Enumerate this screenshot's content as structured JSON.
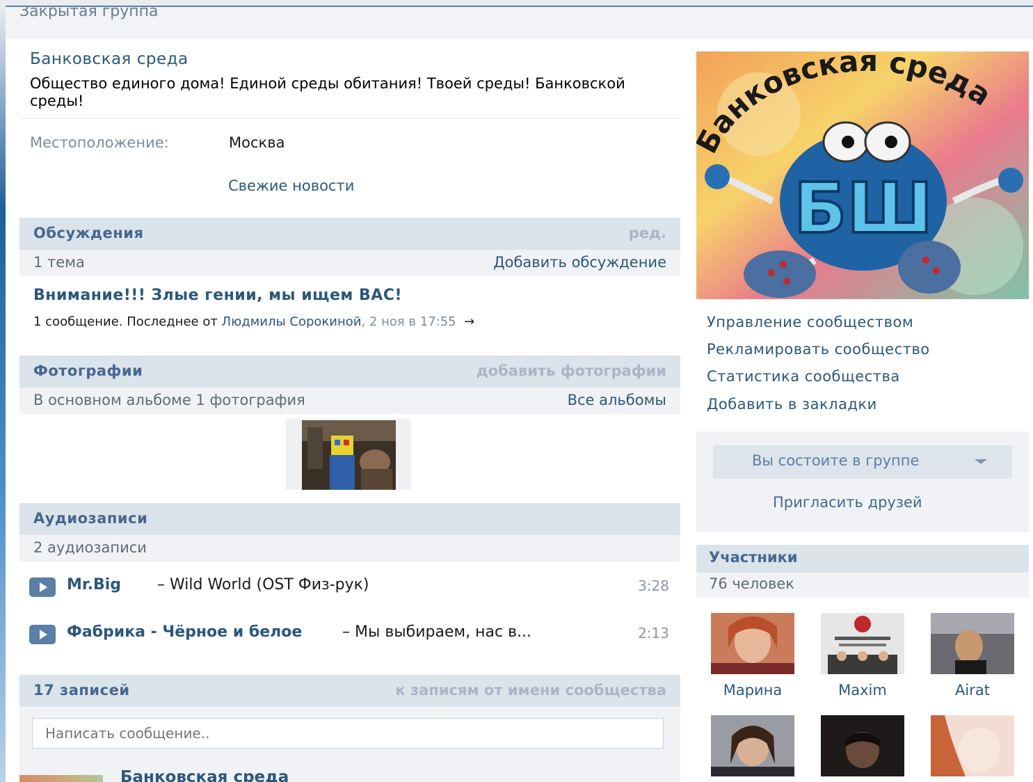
{
  "header": {
    "closed_group_label": "Закрытая группа"
  },
  "group": {
    "name": "Банковская среда",
    "description": "Общество единого дома! Единой среды обитания! Твоей среды! Банковской среды!",
    "location_label": "Местоположение:",
    "location_value": "Москва",
    "fresh_news": "Свежие новости"
  },
  "discussions": {
    "title": "Обсуждения",
    "edit": "ред.",
    "count": "1 тема",
    "add": "Добавить обсуждение",
    "topic": {
      "title": "Внимание!!! Злые гении, мы ищем ВАС!",
      "meta_prefix": "1 сообщение. Последнее от ",
      "meta_author": "Людмилы Сорокиной",
      "meta_date": ", 2 ноя в 17:55",
      "meta_arrow": "→"
    }
  },
  "photos": {
    "title": "Фотографии",
    "add": "добавить фотографии",
    "count": "В основном альбоме 1 фотография",
    "all": "Все альбомы"
  },
  "audio": {
    "title": "Аудиозаписи",
    "count": "2 аудиозаписи",
    "tracks": [
      {
        "artist": "Mr.Big",
        "sep": " – ",
        "title": "Wild World (OST Физ-рук)",
        "duration": "3:28"
      },
      {
        "artist": "Фабрика - Чёрное и белое",
        "sep": " – ",
        "title": "Мы выбираем, нас в...",
        "duration": "2:13"
      }
    ]
  },
  "wall": {
    "count": "17 записей",
    "filter": "к записям от имени сообщества",
    "placeholder": "Написать сообщение..",
    "post_author": "Банковская среда"
  },
  "avatar": {
    "text": "Банковская среда",
    "letters": "БШ"
  },
  "side_links": [
    "Управление сообществом",
    "Рекламировать сообщество",
    "Статистика сообщества",
    "Добавить в закладки"
  ],
  "membership": {
    "status": "Вы состоите в группе",
    "invite": "Пригласить друзей"
  },
  "participants": {
    "title": "Участники",
    "count": "76 человек",
    "members": [
      {
        "name": "Марина"
      },
      {
        "name": "Maxim"
      },
      {
        "name": "Airat"
      }
    ]
  }
}
